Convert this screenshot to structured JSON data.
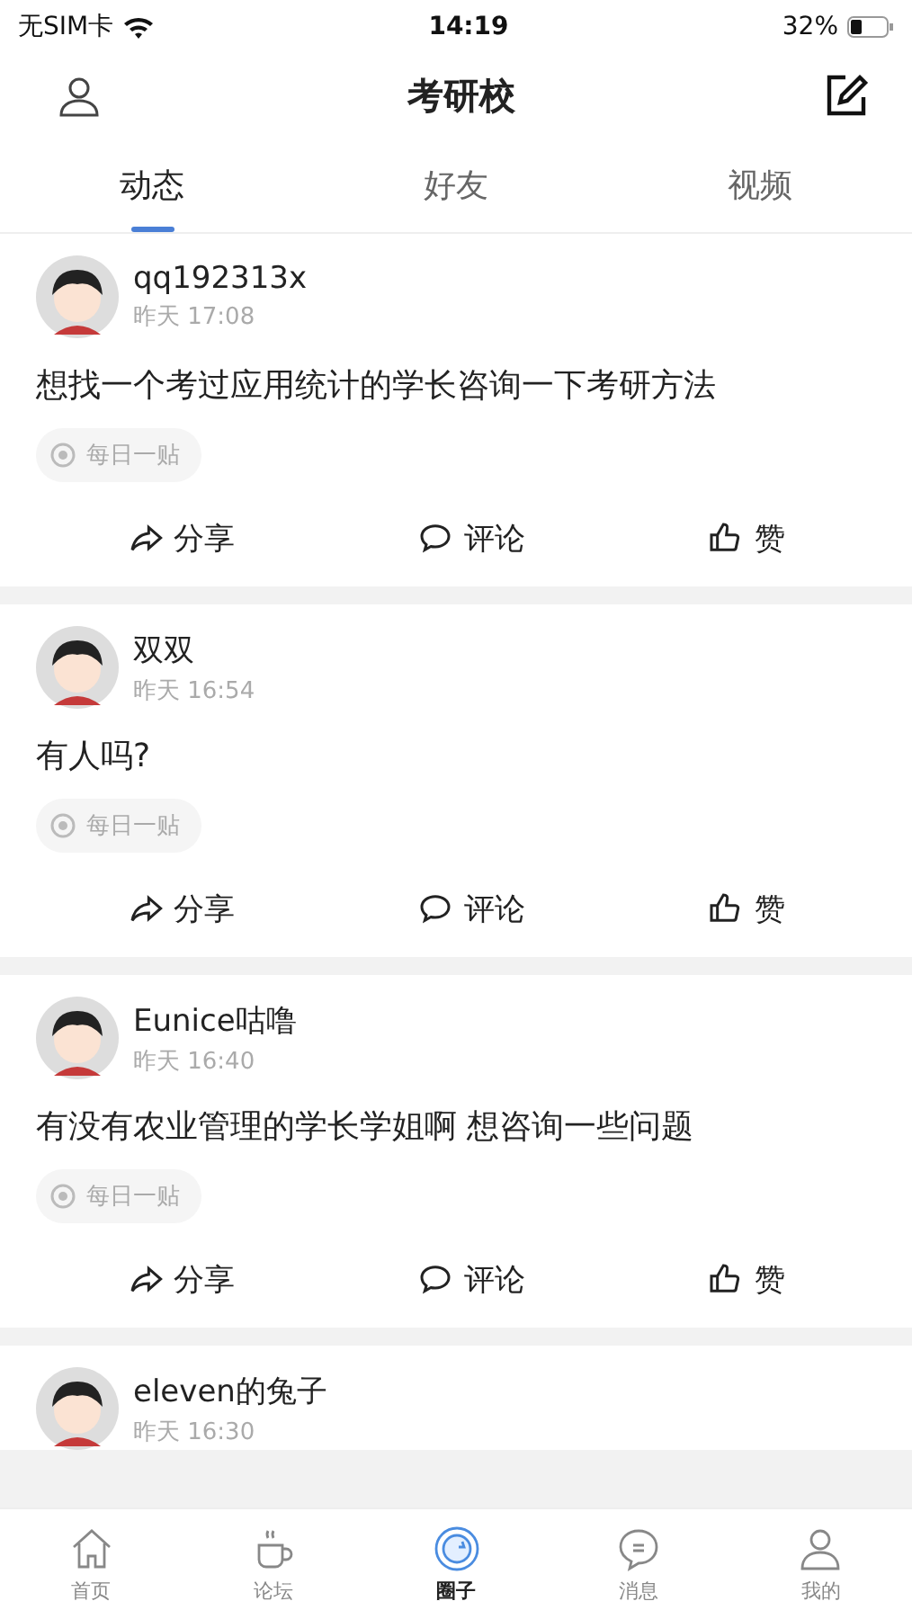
{
  "status_bar": {
    "carrier": "无SIM卡",
    "time": "14:19",
    "battery": "32%"
  },
  "header": {
    "title": "考研校"
  },
  "tabs": [
    {
      "label": "动态",
      "selected": true
    },
    {
      "label": "好友",
      "selected": false
    },
    {
      "label": "视频",
      "selected": false
    }
  ],
  "posts": [
    {
      "author": "qq192313x",
      "time": "昨天 17:08",
      "content": "想找一个考过应用统计的学长咨询一下考研方法",
      "tag": "每日一贴",
      "actions": [
        {
          "kind": "share",
          "label": "分享"
        },
        {
          "kind": "comment",
          "label": "评论"
        },
        {
          "kind": "like",
          "label": "赞"
        }
      ]
    },
    {
      "author": "双双",
      "time": "昨天 16:54",
      "content": "有人吗?",
      "tag": "每日一贴",
      "actions": [
        {
          "kind": "share",
          "label": "分享"
        },
        {
          "kind": "comment",
          "label": "评论"
        },
        {
          "kind": "like",
          "label": "赞"
        }
      ]
    },
    {
      "author": "Eunice咕噜",
      "time": "昨天 16:40",
      "content": "有没有农业管理的学长学姐啊 想咨询一些问题",
      "tag": "每日一贴",
      "actions": [
        {
          "kind": "share",
          "label": "分享"
        },
        {
          "kind": "comment",
          "label": "评论"
        },
        {
          "kind": "like",
          "label": "赞"
        }
      ]
    },
    {
      "author": "eleven的兔子",
      "time": "昨天 16:30"
    }
  ],
  "bottom_nav": [
    {
      "kind": "home",
      "label": "首页",
      "selected": false
    },
    {
      "kind": "forum",
      "label": "论坛",
      "selected": false
    },
    {
      "kind": "circle",
      "label": "圈子",
      "selected": true
    },
    {
      "kind": "message",
      "label": "消息",
      "selected": false
    },
    {
      "kind": "me",
      "label": "我的",
      "selected": false
    }
  ]
}
